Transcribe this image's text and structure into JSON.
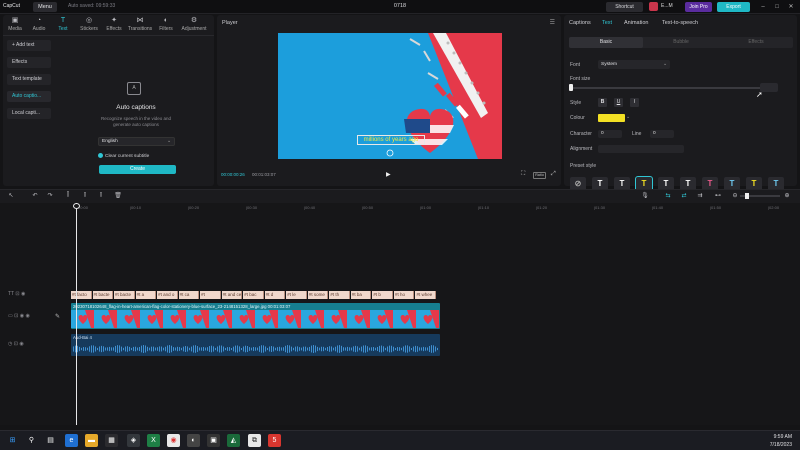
{
  "window": {
    "app_logo": "CapCut",
    "menu_label": "Menu",
    "autosave": "Auto saved: 09:59:33",
    "project_name": "0718",
    "shortcut_label": "Shortcut",
    "user_label": "E...M",
    "joinpro_label": "Join Pro",
    "export_label": "Export"
  },
  "left_tabs": [
    {
      "label": "Media",
      "icon": "media-icon"
    },
    {
      "label": "Audio",
      "icon": "audio-icon"
    },
    {
      "label": "Text",
      "icon": "text-icon"
    },
    {
      "label": "Stickers",
      "icon": "stickers-icon"
    },
    {
      "label": "Effects",
      "icon": "effects-icon"
    },
    {
      "label": "Transitions",
      "icon": "transitions-icon"
    },
    {
      "label": "Filters",
      "icon": "filters-icon"
    },
    {
      "label": "Adjustment",
      "icon": "adjustment-icon"
    }
  ],
  "text_sidebar": [
    "+ Add text",
    "Effects",
    "Text template",
    "Auto captio...",
    "Local capti..."
  ],
  "auto_captions": {
    "title": "Auto captions",
    "description": "Recognize speech in the video and generate auto captions",
    "language": "English",
    "clear_label": "Clear current subtitle",
    "create_label": "Create"
  },
  "player": {
    "title": "Player",
    "caption_text": "millions of years ago",
    "current_time": "00:00:00:26",
    "total_time": "00:01:03:07",
    "ratio_label": "Ratio"
  },
  "right_tabs": [
    "Captions",
    "Text",
    "Animation",
    "Text-to-speech"
  ],
  "right_subtabs": [
    "Basic",
    "Bubble",
    "Effects"
  ],
  "properties": {
    "font_label": "Font",
    "font_value": "System",
    "fontsize_label": "Font size",
    "style_label": "Style",
    "style_buttons": [
      "B",
      "U",
      "I"
    ],
    "colour_label": "Colour",
    "colour_value": "#f3e024",
    "character_label": "Character",
    "character_value": "0",
    "line_label": "Line",
    "line_value": "0",
    "alignment_label": "Alignment",
    "preset_label": "Preset style"
  },
  "timeline": {
    "ticks": [
      "00:00",
      "|00:10",
      "|00:20",
      "|00:30",
      "|00:40",
      "|00:50",
      "|01:00",
      "|01:10",
      "|01:20",
      "|01:30",
      "|01:40",
      "|01:50",
      "|02:00"
    ],
    "text_chips": [
      "#t facto",
      "#t bacte",
      "#t bacte",
      "#t a",
      "#t and o",
      "#t ca",
      "#t",
      "#t and ce",
      "#t bac",
      "#t d",
      "#t le",
      "#t some",
      "#t th",
      "#t ba",
      "#t b",
      "#t ho",
      "#t whee"
    ],
    "video_label": "20230718102648_flag-in-heart-american-flag-color-stationery-blue-surface_23-2148151328_large.jpg   00:01:03:07",
    "audio_label": "Aud-Bai 4"
  },
  "taskbar": {
    "time": "9:59 AM",
    "date": "7/18/2023"
  }
}
